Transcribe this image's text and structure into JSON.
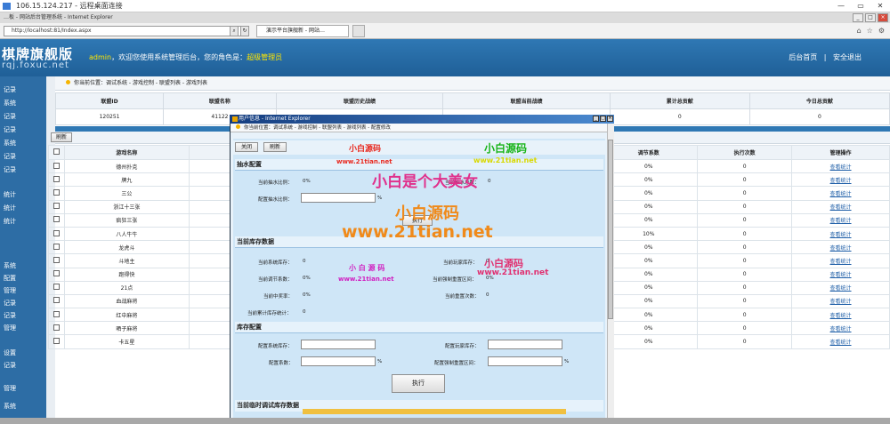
{
  "rdp": {
    "title": "106.15.124.217 - 远程桌面连接"
  },
  "ie": {
    "title": "…板 - 网站后台管理系统 - Internet Explorer",
    "address": "http://localhost:81/Index.aspx",
    "tab": "演示平台旗舰新 - 网站…",
    "rdp_ctrls": [
      "—",
      "▭",
      "✕"
    ],
    "ie_ctrls": [
      "_",
      "□",
      "×"
    ]
  },
  "header": {
    "brand": "棋牌旗舰版",
    "domain": "rqj.foxuc.net",
    "welcome_user": "admin",
    "welcome_mid": "，欢迎您使用系统管理后台，您的角色是：",
    "welcome_role": "超级管理员",
    "link_home": "后台首页",
    "link_sep": "|",
    "link_logout": "安全退出"
  },
  "sidebar": [
    "记录",
    "系统",
    "记录",
    "记录",
    "系统",
    "记录",
    "记录",
    "统计",
    "统计",
    "统计",
    "系统",
    "配置",
    "管理",
    "记录",
    "记录",
    "管理",
    "设置",
    "记录",
    "管理",
    "系统"
  ],
  "breadcrumb": "你当前位置：调试系统 - 游戏控制 - 联盟列表 - 游戏列表",
  "summary": {
    "headers": [
      "联盟ID",
      "联盟名称",
      "联盟历史战绩",
      "联盟当前战绩",
      "累计总贡献",
      "今日总贡献"
    ],
    "values": [
      "120251",
      "41122",
      "-",
      "-",
      "0",
      "0"
    ]
  },
  "toolbar": {
    "refresh": "刷新"
  },
  "grid": {
    "headers": [
      "游戏名称",
      "当前战绩",
      "调节系数",
      "执行次数",
      "管理操作"
    ],
    "action": "查看统计",
    "rows": [
      {
        "name": "德州扑克",
        "score": "0",
        "coef": "0%",
        "count": "0"
      },
      {
        "name": "牌九",
        "score": "0",
        "coef": "0%",
        "count": "0"
      },
      {
        "name": "三公",
        "score": "0",
        "coef": "0%",
        "count": "0"
      },
      {
        "name": "浙江十三张",
        "score": "0",
        "coef": "0%",
        "count": "0"
      },
      {
        "name": "疯狂三张",
        "score": "0",
        "coef": "0%",
        "count": "0"
      },
      {
        "name": "八人牛牛",
        "score": "0",
        "coef": "10%",
        "count": "0"
      },
      {
        "name": "龙虎斗",
        "score": "0",
        "coef": "0%",
        "count": "0"
      },
      {
        "name": "斗地主",
        "score": "0",
        "coef": "0%",
        "count": "0"
      },
      {
        "name": "跑得快",
        "score": "0",
        "coef": "0%",
        "count": "0"
      },
      {
        "name": "21点",
        "score": "0",
        "coef": "0%",
        "count": "0"
      },
      {
        "name": "血战麻将",
        "score": "0",
        "coef": "0%",
        "count": "0"
      },
      {
        "name": "红中麻将",
        "score": "0",
        "coef": "0%",
        "count": "0"
      },
      {
        "name": "晒子麻将",
        "score": "0",
        "coef": "0%",
        "count": "0"
      },
      {
        "name": "卡五星",
        "score": "0",
        "coef": "0%",
        "count": "0"
      }
    ]
  },
  "popup": {
    "title": "用户信息 - Internet Explorer",
    "breadcrumb": "你当前位置：调试系统 - 游戏控制 - 联盟列表 - 游戏列表 - 配置修改",
    "close": "关闭",
    "refresh": "刷新",
    "sec_rake": "抽水配置",
    "rake_cur_label": "当前抽水比例：",
    "rake_cur_val": "0%",
    "rake_total_label": "当前抽水总数：",
    "rake_total_val": "0",
    "rake_cfg_label": "配置抽水比例：",
    "pct": "%",
    "execute": "执行",
    "sec_stock": "当前库存数据",
    "sys_stock_label": "当前系统库存：",
    "sys_stock_val": "0",
    "player_stock_label": "当前玩家库存：",
    "player_stock_val": "0",
    "coef_label": "当前调节系数：",
    "coef_val": "0%",
    "reset_label": "当前强制重置区间：",
    "reset_val": "0%",
    "win_label": "当前中奖率：",
    "win_val": "0%",
    "reset_count_label": "当前重置次数：",
    "reset_count_val": "0",
    "acc_label": "当前累计库存统计：",
    "acc_val": "0",
    "sec_cfg": "库存配置",
    "cfg_sys_label": "配置系统库存：",
    "cfg_player_label": "配置玩家库存：",
    "cfg_coef_label": "配置系数：",
    "cfg_reset_label": "配置强制重置区间：",
    "execute2": "执行",
    "sec_temp": "当前临时调试库存数据"
  },
  "watermarks": {
    "red_small": "小白源码",
    "green_small": "小白源码",
    "url_small": "www.21tian.net",
    "big1": "小白是个大美女",
    "big2": "小白源码",
    "big_url": "www.21tian.net",
    "mid1": "小 白 源 码",
    "mid2": "小白源码"
  }
}
